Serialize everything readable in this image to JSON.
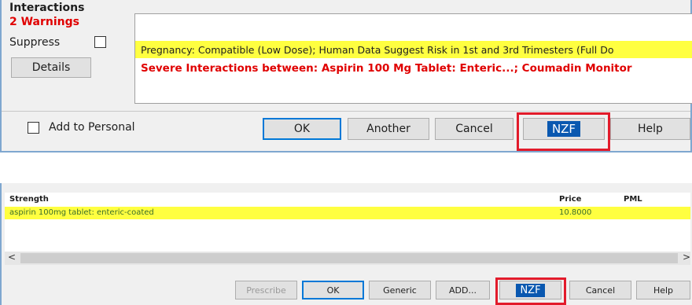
{
  "top": {
    "interactions_label": "Interactions",
    "warnings_label": "2 Warnings",
    "suppress_label": "Suppress",
    "details_button": "Details",
    "messages": [
      "Pregnancy: Compatible (Low Dose); Human Data Suggest Risk in 1st and 3rd Trimesters (Full Do",
      "Severe Interactions between: Aspirin 100 Mg Tablet: Enteric...; Coumadin Monitor"
    ],
    "add_to_personal_label": "Add to Personal",
    "buttons": {
      "ok": "OK",
      "another": "Another",
      "cancel": "Cancel",
      "nzf": "NZF",
      "help": "Help"
    }
  },
  "bottom": {
    "columns": {
      "strength": "Strength",
      "price": "Price",
      "pml": "PML"
    },
    "rows": [
      {
        "strength": "aspirin 100mg tablet: enteric-coated",
        "price": "10.8000",
        "pml": ""
      }
    ],
    "scroll_left": "<",
    "scroll_right": ">",
    "buttons": {
      "prescribe": "Prescribe",
      "ok": "OK",
      "generic": "Generic",
      "add": "ADD...",
      "nzf": "NZF",
      "cancel": "Cancel",
      "help": "Help"
    }
  },
  "colors": {
    "highlight": "#ffff40",
    "warning_red": "#e00000",
    "nzf_blue": "#0a58b0",
    "callout_red": "#e21b2b",
    "default_button_border": "#0078d7"
  }
}
